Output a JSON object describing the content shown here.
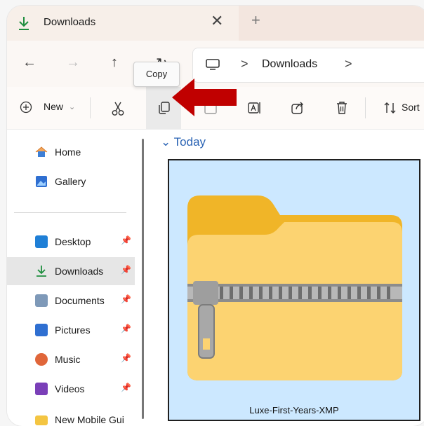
{
  "window": {
    "tab_title": "Downloads",
    "close_glyph": "✕",
    "new_tab_glyph": "+"
  },
  "nav": {
    "back_glyph": "←",
    "forward_glyph": "→",
    "up_glyph": "↑",
    "refresh_glyph": "↻"
  },
  "breadcrumb": {
    "items": [
      "Downloads"
    ],
    "separator": ">"
  },
  "tooltip": {
    "text": "Copy"
  },
  "toolbar": {
    "new_label": "New",
    "new_chevron": "⌄",
    "sort_label": "Sort"
  },
  "sidebar": {
    "items": [
      {
        "label": "Home",
        "icon": "home-icon",
        "pinned": false
      },
      {
        "label": "Gallery",
        "icon": "gallery-icon",
        "pinned": false
      },
      {
        "label": "Desktop",
        "icon": "desktop-icon",
        "pinned": true
      },
      {
        "label": "Downloads",
        "icon": "downloads-icon",
        "pinned": true,
        "active": true
      },
      {
        "label": "Documents",
        "icon": "documents-icon",
        "pinned": true
      },
      {
        "label": "Pictures",
        "icon": "pictures-icon",
        "pinned": true
      },
      {
        "label": "Music",
        "icon": "music-icon",
        "pinned": true
      },
      {
        "label": "Videos",
        "icon": "videos-icon",
        "pinned": true
      },
      {
        "label": "New Mobile Gui",
        "icon": "folder-icon",
        "pinned": false
      }
    ],
    "pin_glyph": "📌"
  },
  "content": {
    "group_header": "Today",
    "group_chevron": "⌄",
    "file": {
      "name": "Luxe-First-Years-XMP",
      "type": "zip-folder"
    }
  },
  "colors": {
    "accent": "#2a63b4",
    "selection": "#cce8ff",
    "arrow": "#c00000",
    "download_green": "#1e8e3e"
  }
}
